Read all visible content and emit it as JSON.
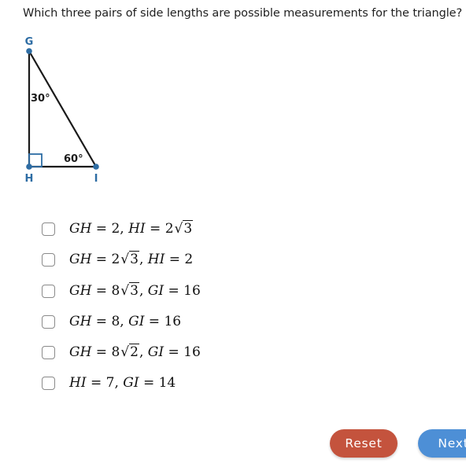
{
  "question": "Which three pairs of side lengths are possible measurements for the triangle?",
  "diagram": {
    "vertices": {
      "G": "G",
      "H": "H",
      "I": "I"
    },
    "angles": {
      "G": "30°",
      "I": "60°"
    },
    "right_angle_at": "H",
    "vertex_color": "#2e6da4",
    "line_color": "#1a1a1a"
  },
  "options": [
    {
      "checked": false,
      "parts": [
        {
          "var": "GH",
          "eq": "2"
        },
        {
          "var": "HI",
          "coef": "2",
          "rad": "3"
        }
      ]
    },
    {
      "checked": false,
      "parts": [
        {
          "var": "GH",
          "coef": "2",
          "rad": "3"
        },
        {
          "var": "HI",
          "eq": "2"
        }
      ]
    },
    {
      "checked": false,
      "parts": [
        {
          "var": "GH",
          "coef": "8",
          "rad": "3"
        },
        {
          "var": "GI",
          "eq": "16"
        }
      ]
    },
    {
      "checked": false,
      "parts": [
        {
          "var": "GH",
          "eq": "8"
        },
        {
          "var": "GI",
          "eq": "16"
        }
      ]
    },
    {
      "checked": false,
      "parts": [
        {
          "var": "GH",
          "coef": "8",
          "rad": "2"
        },
        {
          "var": "GI",
          "eq": "16"
        }
      ]
    },
    {
      "checked": false,
      "parts": [
        {
          "var": "HI",
          "eq": "7"
        },
        {
          "var": "GI",
          "eq": "14"
        }
      ]
    }
  ],
  "buttons": {
    "reset": "Reset",
    "next": "Next",
    "reset_color": "#c4533d",
    "next_color": "#4d8fd6"
  }
}
